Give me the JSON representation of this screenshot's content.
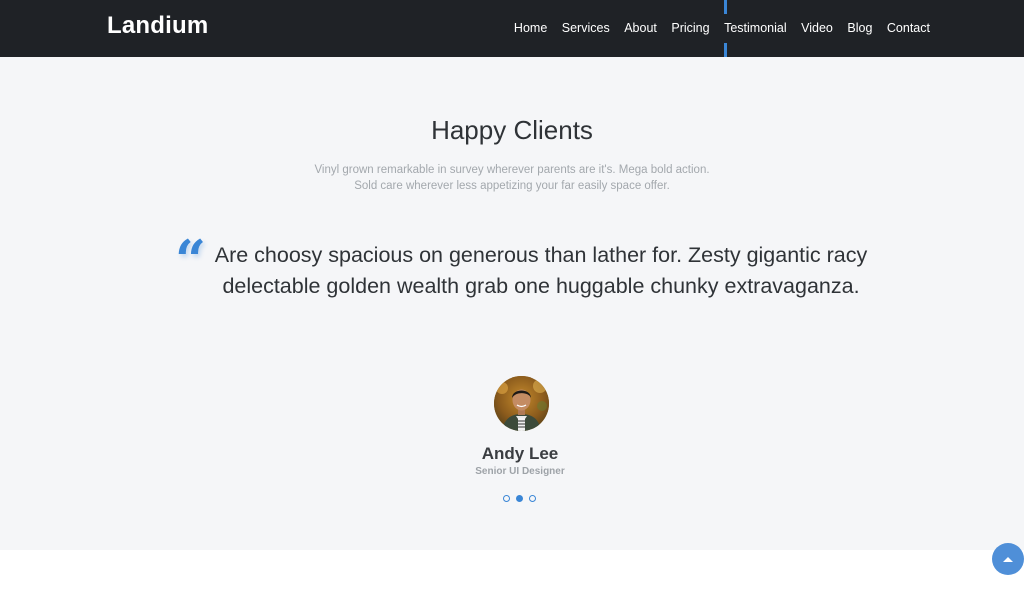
{
  "navbar": {
    "brand": "Landium",
    "links": [
      "Home",
      "Services",
      "About",
      "Pricing",
      "Testimonial",
      "Video",
      "Blog",
      "Contact"
    ],
    "active": "Testimonial"
  },
  "testimonials": {
    "title": "Happy Clients",
    "subtitle_line1": "Vinyl grown remarkable in survey wherever parents are it's. Mega bold action.",
    "subtitle_line2": "Sold care wherever less appetizing your far easily space offer.",
    "quote": "Are choosy spacious on generous than lather for. Zesty gigantic racy delectable golden wealth grab one huggable chunky extravaganza.",
    "quote_icon": "quote-icon",
    "client_name": "Andy Lee",
    "client_role": "Senior UI Designer",
    "slider": {
      "count": 3,
      "active_index": 1
    }
  },
  "scroll_top_icon": "chevron-up-icon",
  "colors": {
    "accent": "#3a86d6",
    "navbar_bg": "#1f2226",
    "section_bg": "#f5f6f8"
  }
}
